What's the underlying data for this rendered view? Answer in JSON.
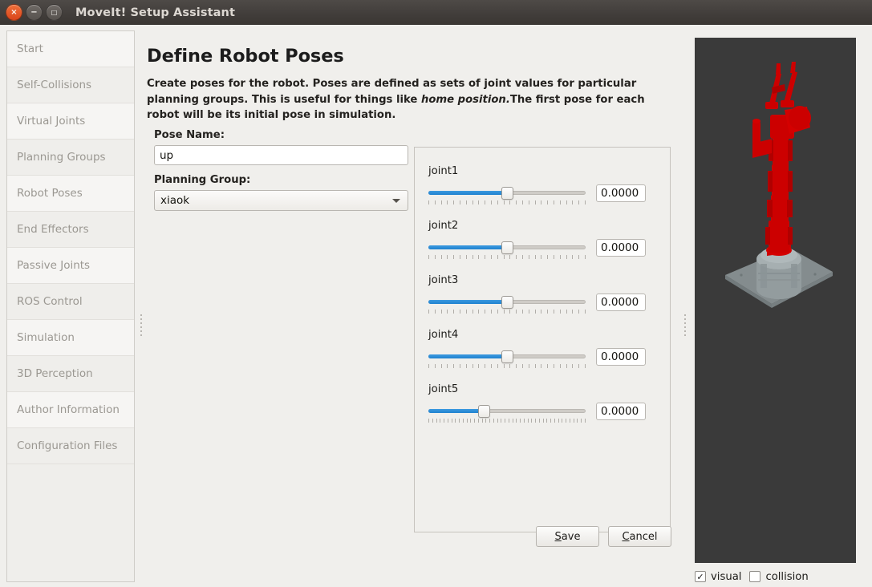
{
  "window": {
    "title": "MoveIt! Setup Assistant",
    "controls": {
      "close": "×",
      "minimize": "−",
      "maximize": "□"
    }
  },
  "sidebar": {
    "items": [
      {
        "label": "Start"
      },
      {
        "label": "Self-Collisions"
      },
      {
        "label": "Virtual Joints"
      },
      {
        "label": "Planning Groups"
      },
      {
        "label": "Robot Poses"
      },
      {
        "label": "End Effectors"
      },
      {
        "label": "Passive Joints"
      },
      {
        "label": "ROS Control"
      },
      {
        "label": "Simulation"
      },
      {
        "label": "3D Perception"
      },
      {
        "label": "Author Information"
      },
      {
        "label": "Configuration Files"
      }
    ]
  },
  "main": {
    "title": "Define Robot Poses",
    "description_part1": "Create poses for the robot. Poses are defined as sets of joint values for particular planning groups. This is useful for things like ",
    "description_italic": "home position.",
    "description_part2": "The first pose for each robot will be its initial pose in simulation.",
    "pose_name_label": "Pose Name:",
    "pose_name_value": "up",
    "planning_group_label": "Planning Group:",
    "planning_group_value": "xiaok",
    "joints": [
      {
        "name": "joint1",
        "value": "0.0000",
        "percent": 50,
        "ticks": 26
      },
      {
        "name": "joint2",
        "value": "0.0000",
        "percent": 50,
        "ticks": 26
      },
      {
        "name": "joint3",
        "value": "0.0000",
        "percent": 50,
        "ticks": 26
      },
      {
        "name": "joint4",
        "value": "0.0000",
        "percent": 50,
        "ticks": 26
      },
      {
        "name": "joint5",
        "value": "0.0000",
        "percent": 35,
        "ticks": 42
      }
    ],
    "save_button": "Save",
    "save_mnemonic": "S",
    "save_rest": "ave",
    "cancel_button": "Cancel",
    "cancel_mnemonic": "C",
    "cancel_rest": "ancel"
  },
  "viewer": {
    "background_color": "#3a3a3a",
    "robot_color": "#cc0000",
    "ground_color": "#8d9698",
    "visual_label": "visual",
    "visual_checked": true,
    "visual_mark": "✓",
    "collision_label": "collision",
    "collision_checked": false,
    "collision_mark": ""
  }
}
